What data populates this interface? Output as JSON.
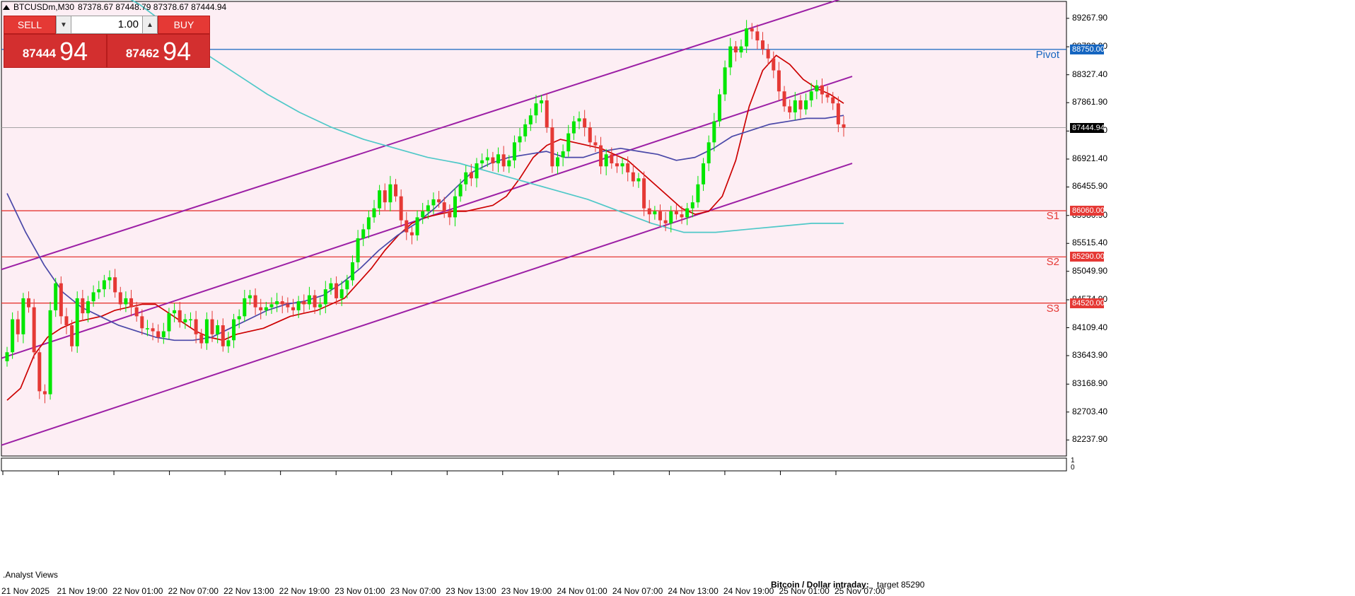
{
  "symbol_header": {
    "symbol_label": "BTCUSDm,M30",
    "prices": "87378.67 87448.79 87378.67 87444.94"
  },
  "trade_panel": {
    "sell_label": "SELL",
    "buy_label": "BUY",
    "volume": "1.00",
    "sell_small": "87444",
    "sell_big": "94",
    "buy_small": "87462",
    "buy_big": "94"
  },
  "indicator_window_label": ".Analyst Views",
  "analysis_note": {
    "title": "Bitcoin / Dollar intraday:",
    "text": "target 85290"
  },
  "subwindow_axis": [
    "1",
    "0"
  ],
  "levels": [
    {
      "name": "Pivot",
      "value": 88750.0,
      "tag": "88750.00",
      "color": "#1565c0"
    },
    {
      "name": "S1",
      "value": 86060.0,
      "tag": "86060.00",
      "color": "#e53935"
    },
    {
      "name": "S2",
      "value": 85290.0,
      "tag": "85290.00",
      "color": "#e53935"
    },
    {
      "name": "S3",
      "value": 84520.0,
      "tag": "84520.00",
      "color": "#e53935"
    }
  ],
  "current_price": {
    "value": 87444.94,
    "tag": "87444.94"
  },
  "colors": {
    "background": "#fdeef4",
    "bull": "#00e600",
    "bear": "#e53935",
    "channel": "#9c1fa5",
    "ma_fast": "#cc0000",
    "ma_mid": "#4a48a8",
    "ma_slow": "#4fc8c8"
  },
  "chart_data": {
    "type": "candlestick",
    "ylim": [
      81970,
      89550
    ],
    "price_ticks": [
      89267.9,
      88793.9,
      88327.4,
      87861.9,
      87388.9,
      86921.4,
      86455.9,
      85980.9,
      85515.4,
      85049.9,
      84574.9,
      84109.4,
      83643.9,
      83168.9,
      82703.4,
      82237.9
    ],
    "time_labels": [
      "21 Nov 2025",
      "21 Nov 19:00",
      "22 Nov 01:00",
      "22 Nov 07:00",
      "22 Nov 13:00",
      "22 Nov 19:00",
      "23 Nov 01:00",
      "23 Nov 07:00",
      "23 Nov 13:00",
      "23 Nov 19:00",
      "24 Nov 01:00",
      "24 Nov 07:00",
      "24 Nov 13:00",
      "24 Nov 19:00",
      "25 Nov 01:00",
      "25 Nov 07:00"
    ],
    "candle_closes": [
      83700,
      84250,
      84000,
      84600,
      84450,
      83700,
      83050,
      83000,
      84400,
      84850,
      84300,
      84150,
      83800,
      84600,
      84350,
      84550,
      84700,
      84750,
      84900,
      84950,
      84700,
      84500,
      84600,
      84450,
      84300,
      84100,
      84100,
      84050,
      83950,
      84050,
      84350,
      84400,
      84200,
      84250,
      84250,
      84000,
      83850,
      84250,
      84000,
      84150,
      83800,
      83900,
      84250,
      84300,
      84600,
      84650,
      84450,
      84400,
      84450,
      84500,
      84550,
      84500,
      84450,
      84400,
      84550,
      84500,
      84650,
      84450,
      84500,
      84750,
      84850,
      84600,
      84750,
      84900,
      85200,
      85600,
      85750,
      85950,
      86100,
      86400,
      86200,
      86500,
      86300,
      85900,
      85700,
      85650,
      85950,
      86050,
      86150,
      86250,
      86200,
      86050,
      85950,
      86300,
      86500,
      86700,
      86600,
      86850,
      86900,
      86950,
      86850,
      87000,
      86800,
      86900,
      87200,
      87300,
      87500,
      87650,
      87850,
      87900,
      87450,
      86800,
      86950,
      87050,
      87350,
      87550,
      87600,
      87450,
      87200,
      87150,
      86800,
      87000,
      86850,
      86800,
      86850,
      86700,
      86550,
      86600,
      86100,
      86000,
      86050,
      85900,
      85850,
      86050,
      86000,
      85950,
      86100,
      86200,
      86500,
      86850,
      87200,
      87550,
      88000,
      88450,
      88800,
      88700,
      88800,
      89100,
      89050,
      88900,
      88750,
      88600,
      88400,
      88050,
      87800,
      87700,
      87900,
      87750,
      87900,
      88050,
      88150,
      88000,
      87950,
      87850,
      87500,
      87444.94
    ],
    "series": [
      {
        "name": "",
        "values": [
          82900,
          83100,
          83650,
          83950,
          84100,
          84200,
          84250,
          84300,
          84400,
          84450,
          84500,
          84500,
          84350,
          84200,
          84050,
          83950,
          83900,
          84000,
          84050,
          84100,
          84200,
          84300,
          84350,
          84400,
          84500,
          84600,
          84850,
          85100,
          85400,
          85650,
          85850,
          85950,
          86000,
          86050,
          86050,
          86100,
          86150,
          86300,
          86600,
          86950,
          87150,
          87250,
          87200,
          87150,
          87100,
          87000,
          86900,
          86700,
          86500,
          86300,
          86100,
          86000,
          86050,
          86300,
          86900,
          87800,
          88400,
          88650,
          88500,
          88250,
          88100,
          88000,
          87850
        ]
      },
      {
        "name": "",
        "values": [
          86350,
          85700,
          85150,
          84700,
          84450,
          84300,
          84150,
          84050,
          83950,
          83900,
          83900,
          83950,
          84100,
          84250,
          84400,
          84500,
          84550,
          84650,
          84850,
          85100,
          85400,
          85650,
          85850,
          86100,
          86400,
          86700,
          86850,
          86950,
          87000,
          87050,
          86950,
          86950,
          87050,
          87100,
          87050,
          87000,
          86900,
          86950,
          87100,
          87300,
          87400,
          87500,
          87550,
          87600,
          87600,
          87650
        ]
      },
      {
        "name": "",
        "values": [
          89800,
          89500,
          89100,
          88700,
          88350,
          88000,
          87700,
          87450,
          87250,
          87100,
          86950,
          86850,
          86700,
          86550,
          86400,
          86250,
          86050,
          85850,
          85700,
          85700,
          85750,
          85800,
          85850,
          85850
        ]
      }
    ],
    "channel": [
      {
        "name": "upper",
        "start": [
          0.0,
          85080
        ],
        "end": [
          1.0,
          89650
        ]
      },
      {
        "name": "middle",
        "start": [
          0.0,
          83600
        ],
        "end": [
          1.0,
          88300
        ]
      },
      {
        "name": "lower",
        "start": [
          0.0,
          82150
        ],
        "end": [
          1.0,
          86850
        ]
      }
    ]
  }
}
